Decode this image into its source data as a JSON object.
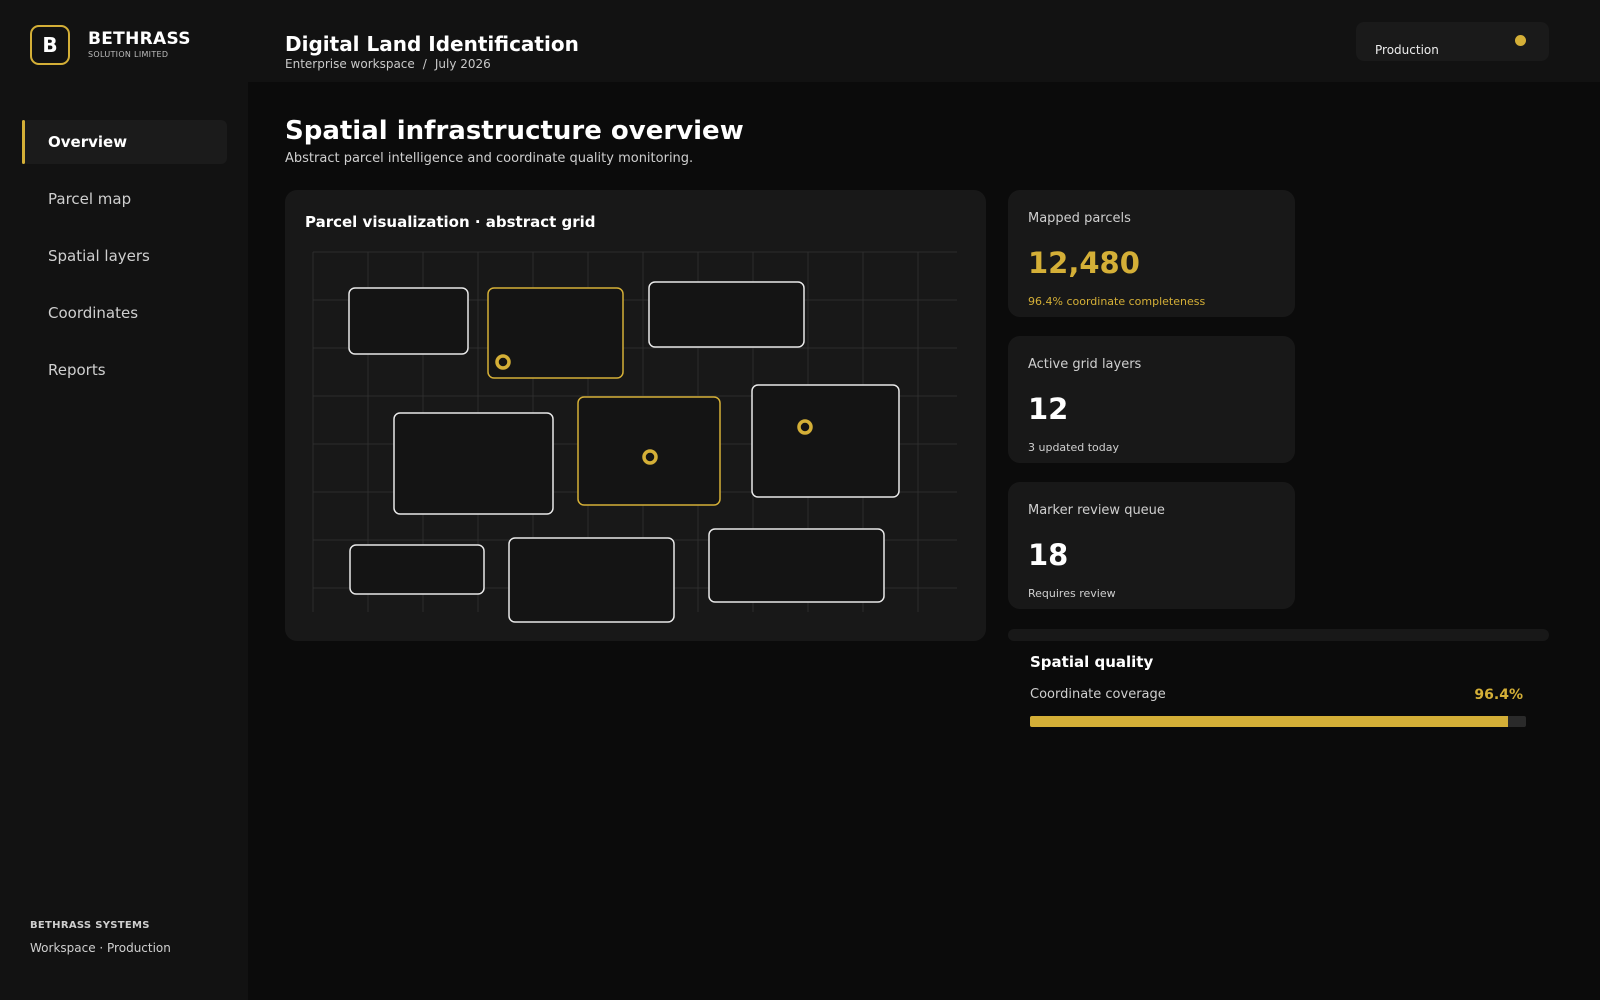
{
  "brand": {
    "mark": "B",
    "name": "BETHRASS",
    "sub": "SOLUTION LIMITED"
  },
  "sidebar": {
    "items": [
      {
        "label": "Overview",
        "active": true
      },
      {
        "label": "Parcel map",
        "active": false
      },
      {
        "label": "Spatial layers",
        "active": false
      },
      {
        "label": "Coordinates",
        "active": false
      },
      {
        "label": "Reports",
        "active": false
      }
    ],
    "footer": {
      "title": "BETHRASS SYSTEMS",
      "sub": "Workspace · Production"
    }
  },
  "header": {
    "title": "Digital Land Identification",
    "crumb_workspace": "Enterprise workspace",
    "crumb_separator": "/",
    "crumb_date": "July 2026",
    "environment": "Production"
  },
  "page": {
    "title": "Spatial infrastructure overview",
    "subtitle": "Abstract parcel intelligence and coordinate quality monitoring."
  },
  "visualization": {
    "title": "Parcel visualization · abstract grid",
    "highlight_color": "#d4af37",
    "outline_color": "#e8e8e8",
    "parcel_count": 9,
    "highlighted_parcels": 2,
    "marker_count": 3
  },
  "stats": [
    {
      "label": "Mapped parcels",
      "value": "12,480",
      "sub": "96.4% coordinate completeness",
      "accent": true
    },
    {
      "label": "Active grid layers",
      "value": "12",
      "sub": "3 updated today",
      "accent": false
    },
    {
      "label": "Marker review queue",
      "value": "18",
      "sub": "Requires review",
      "accent": false
    }
  ],
  "quality": {
    "title": "Spatial quality",
    "label": "Coordinate coverage",
    "percent_text": "96.4%",
    "percent_value": 96.4
  },
  "colors": {
    "accent": "#d4af37",
    "background": "#0b0b0b",
    "panel": "#121212",
    "card": "#181818"
  }
}
